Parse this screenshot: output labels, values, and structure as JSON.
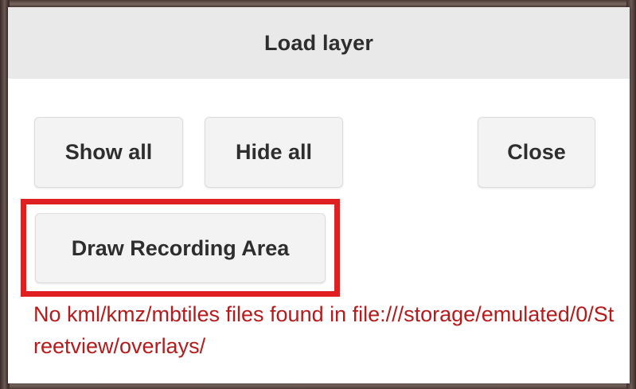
{
  "dialog": {
    "title": "Load layer",
    "buttons": {
      "show_all": "Show all",
      "hide_all": "Hide all",
      "close": "Close",
      "draw_recording_area": "Draw Recording Area"
    },
    "error_message": "No kml/kmz/mbtiles files found in file:///storage/emulated/0/Streetview/overlays/"
  },
  "colors": {
    "header_background": "#e9e9e9",
    "button_background": "#f3f3f3",
    "error_text": "#b61a1a",
    "highlight_border": "#e02020"
  }
}
